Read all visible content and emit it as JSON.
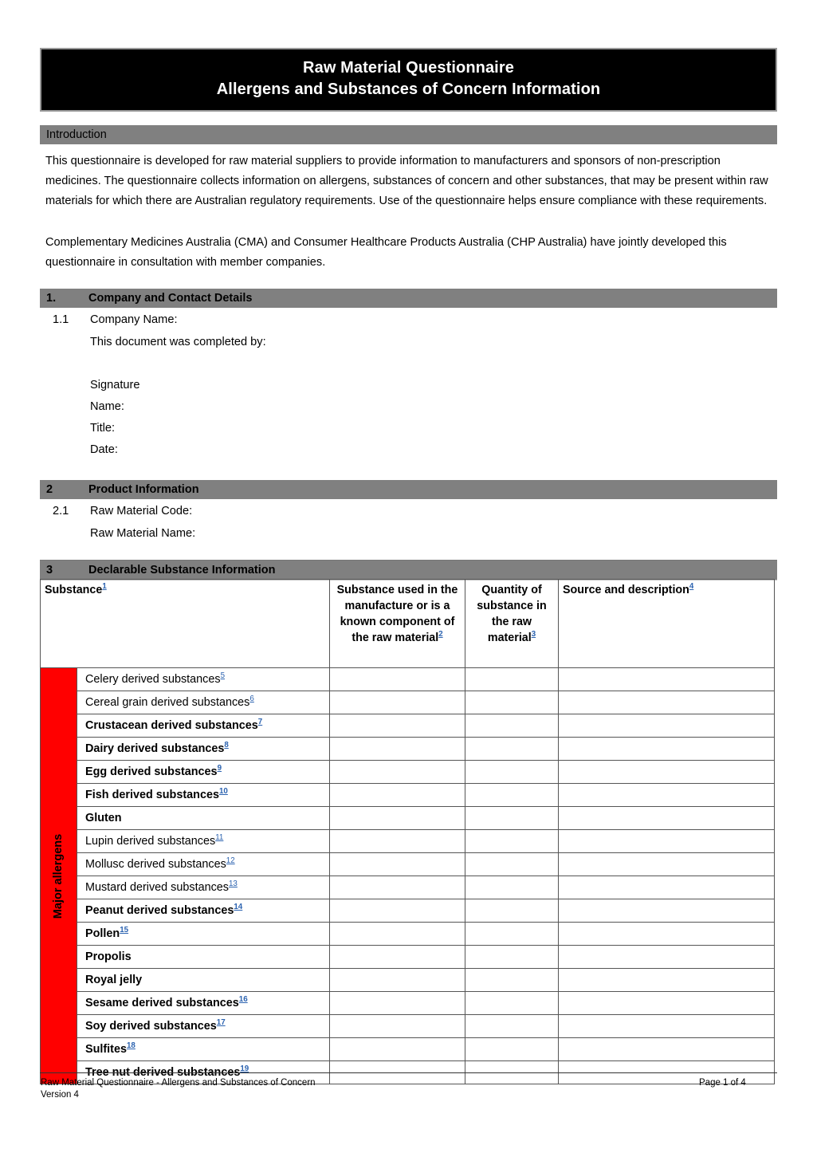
{
  "title": {
    "line1": "Raw Material Questionnaire",
    "line2": "Allergens and Substances of Concern Information"
  },
  "introduction": {
    "heading": "Introduction",
    "paragraph1": "This questionnaire is developed for raw material suppliers to provide information to manufacturers and sponsors of non-prescription medicines. The questionnaire collects information on allergens, substances of concern and other substances, that may be present within raw materials for which there are Australian regulatory requirements. Use of the questionnaire helps ensure compliance with these requirements.",
    "paragraph2": "Complementary Medicines Australia (CMA) and Consumer Healthcare Products Australia (CHP Australia) have jointly developed this questionnaire in consultation with member companies."
  },
  "section1": {
    "number": "1.",
    "heading": "Company and Contact Details",
    "item_number": "1.1",
    "company_name_label": "Company Name:",
    "completed_by_label": "This document was completed by:",
    "signature_label": "Signature",
    "name_label": "Name:",
    "title_label": "Title:",
    "date_label": "Date:"
  },
  "section2": {
    "number": "2",
    "heading": "Product Information",
    "item_number": "2.1",
    "raw_material_code_label": "Raw Material Code:",
    "raw_material_name_label": "Raw Material Name:"
  },
  "section3": {
    "number": "3",
    "heading": "Declarable Substance Information",
    "group_label": "Major allergens",
    "columns": {
      "substance": "Substance",
      "substance_ref": "1",
      "used_in_manufacture": "Substance used in the manufacture or is a known component of the raw material",
      "used_in_manufacture_ref": "2",
      "quantity": "Quantity of substance in the raw material",
      "quantity_ref": "3",
      "source": "Source and description",
      "source_ref": "4"
    },
    "rows": [
      {
        "label": "Celery derived substances",
        "ref": "5",
        "bold": false,
        "used": "",
        "quantity": "",
        "source": ""
      },
      {
        "label": "Cereal grain derived substances",
        "ref": "6",
        "bold": false,
        "used": "",
        "quantity": "",
        "source": ""
      },
      {
        "label": "Crustacean derived substances",
        "ref": "7",
        "bold": true,
        "used": "",
        "quantity": "",
        "source": ""
      },
      {
        "label": "Dairy derived substances",
        "ref": "8",
        "bold": true,
        "used": "",
        "quantity": "",
        "source": ""
      },
      {
        "label": "Egg derived substances",
        "ref": "9",
        "bold": true,
        "used": "",
        "quantity": "",
        "source": ""
      },
      {
        "label": "Fish derived substances",
        "ref": "10",
        "bold": true,
        "used": "",
        "quantity": "",
        "source": ""
      },
      {
        "label": "Gluten",
        "ref": "",
        "bold": true,
        "used": "",
        "quantity": "",
        "source": ""
      },
      {
        "label": "Lupin derived substances",
        "ref": "11",
        "bold": false,
        "used": "",
        "quantity": "",
        "source": ""
      },
      {
        "label": "Mollusc derived substances",
        "ref": "12",
        "bold": false,
        "used": "",
        "quantity": "",
        "source": ""
      },
      {
        "label": "Mustard derived substances",
        "ref": "13",
        "bold": false,
        "used": "",
        "quantity": "",
        "source": ""
      },
      {
        "label": "Peanut derived substances",
        "ref": "14",
        "bold": true,
        "used": "",
        "quantity": "",
        "source": ""
      },
      {
        "label": "Pollen",
        "ref": "15",
        "bold": true,
        "used": "",
        "quantity": "",
        "source": ""
      },
      {
        "label": "Propolis",
        "ref": "",
        "bold": true,
        "used": "",
        "quantity": "",
        "source": ""
      },
      {
        "label": "Royal jelly",
        "ref": "",
        "bold": true,
        "used": "",
        "quantity": "",
        "source": ""
      },
      {
        "label": "Sesame derived substances",
        "ref": "16",
        "bold": true,
        "used": "",
        "quantity": "",
        "source": ""
      },
      {
        "label": "Soy derived substances",
        "ref": "17",
        "bold": true,
        "used": "",
        "quantity": "",
        "source": ""
      },
      {
        "label": "Sulfites",
        "ref": "18",
        "bold": true,
        "used": "",
        "quantity": "",
        "source": ""
      },
      {
        "label": "Tree nut derived substances",
        "ref": "19",
        "bold": true,
        "used": "",
        "quantity": "",
        "source": ""
      }
    ]
  },
  "footer": {
    "left_line1": "Raw Material Questionnaire - Allergens and Substances of Concern",
    "left_line2": "Version 4",
    "right": "Page 1 of 4"
  },
  "colors": {
    "title_background": "#000000",
    "title_text": "#ffffff",
    "section_bar": "#808080",
    "allergen_band": "#FF0000",
    "reference_link": "#2C63B0"
  }
}
